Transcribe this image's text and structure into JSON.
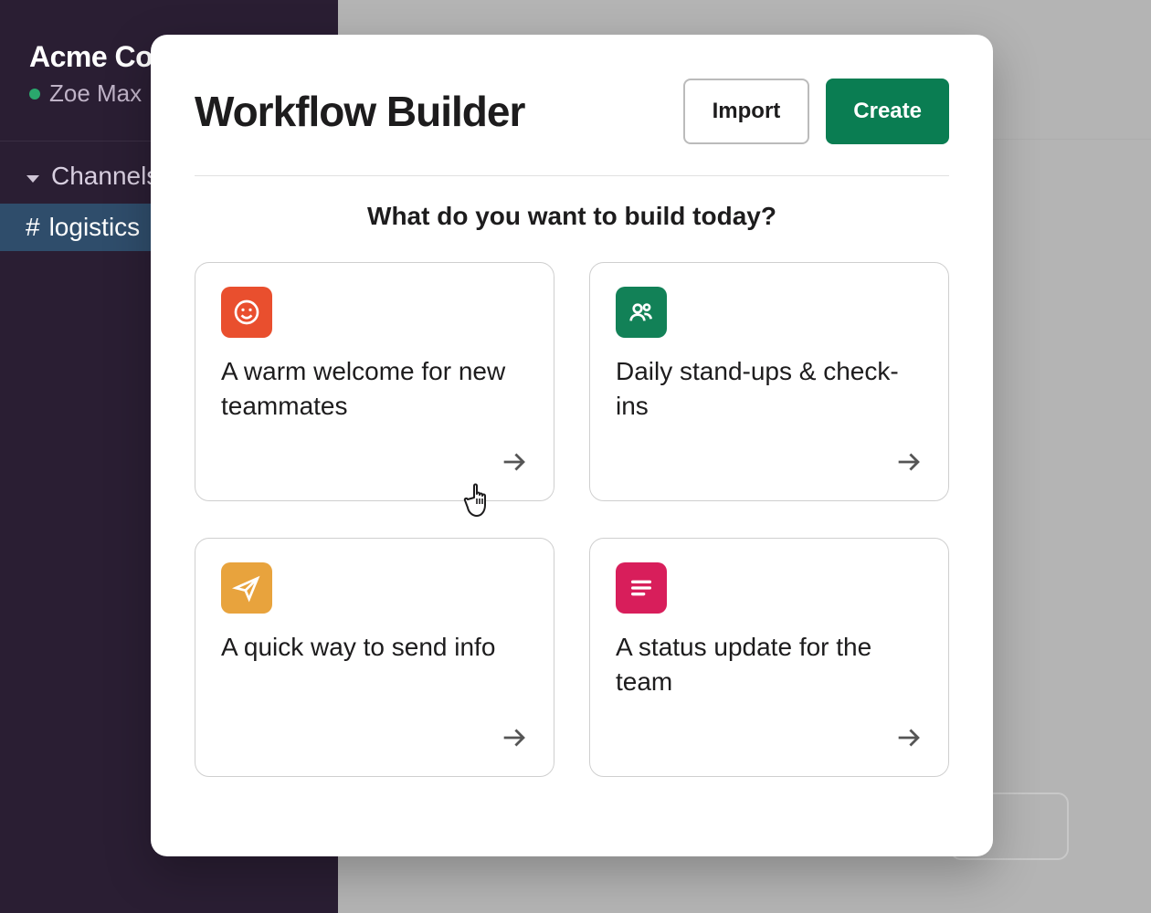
{
  "sidebar": {
    "workspace_name": "Acme Co",
    "user_name": "Zoe Max",
    "channels_label": "Channels",
    "channels": [
      {
        "name": "logistics",
        "selected": true
      }
    ]
  },
  "modal": {
    "title": "Workflow Builder",
    "import_label": "Import",
    "create_label": "Create",
    "prompt": "What do you want to build today?",
    "cards": [
      {
        "title": "A warm welcome for new teammates",
        "icon": "smile",
        "color": "orange"
      },
      {
        "title": "Daily stand-ups & check-ins",
        "icon": "people",
        "color": "green"
      },
      {
        "title": "A quick way to send info",
        "icon": "paper-plane",
        "color": "amber"
      },
      {
        "title": "A status update for the team",
        "icon": "list",
        "color": "pink"
      }
    ]
  },
  "colors": {
    "sidebar_bg": "#2a1e33",
    "accent_green": "#0a7d52",
    "icon_orange": "#e94f2e",
    "icon_green": "#128157",
    "icon_amber": "#e8a33d",
    "icon_pink": "#d81e5b"
  }
}
